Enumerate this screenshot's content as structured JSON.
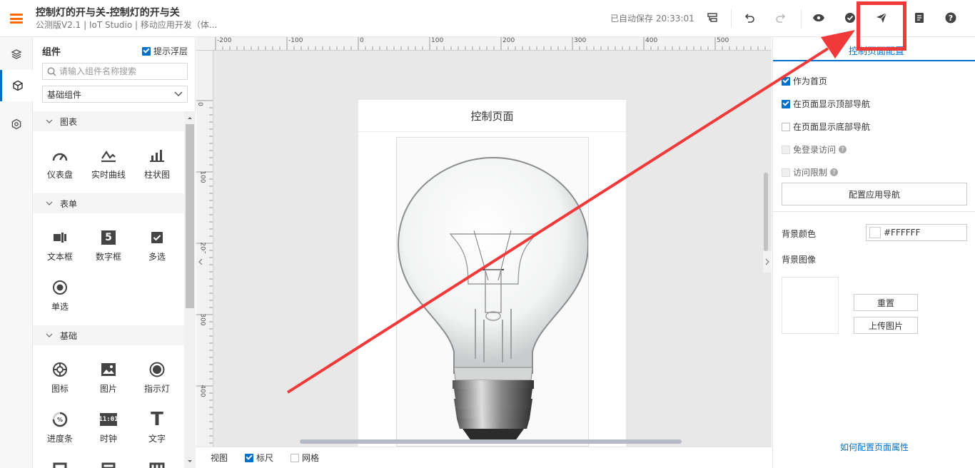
{
  "header": {
    "title": "控制灯的开与关-控制灯的开与关",
    "subtitle": "公测版V2.1 | IoT Studio | 移动应用开发（体...",
    "autosave": "已自动保存 20:33:01"
  },
  "components_panel": {
    "title": "组件",
    "hint_label": "提示浮层",
    "hint_checked": true,
    "search_placeholder": "请输入组件名称搜索",
    "category_select": "基础组件",
    "categories": [
      {
        "label": "图表",
        "items": [
          {
            "label": "仪表盘",
            "icon": "gauge-icon"
          },
          {
            "label": "实时曲线",
            "icon": "realtime-curve-icon"
          },
          {
            "label": "柱状图",
            "icon": "bar-chart-icon"
          }
        ]
      },
      {
        "label": "表单",
        "items": [
          {
            "label": "文本框",
            "icon": "textbox-icon"
          },
          {
            "label": "数字框",
            "icon": "number-box-icon"
          },
          {
            "label": "多选",
            "icon": "checkbox-icon"
          },
          {
            "label": "单选",
            "icon": "radio-icon"
          }
        ]
      },
      {
        "label": "基础",
        "items": [
          {
            "label": "图标",
            "icon": "icon-component-icon"
          },
          {
            "label": "图片",
            "icon": "image-icon"
          },
          {
            "label": "指示灯",
            "icon": "indicator-light-icon"
          },
          {
            "label": "进度条",
            "icon": "progress-icon"
          },
          {
            "label": "时钟",
            "icon": "clock-icon"
          },
          {
            "label": "文字",
            "icon": "text-icon"
          }
        ]
      }
    ],
    "number_icon_glyph": "5",
    "clock_icon_glyph": "11:01",
    "text_icon_glyph": "T"
  },
  "canvas": {
    "page_title": "控制页面",
    "ruler_h_labels": [
      "-200",
      "-100",
      "0",
      "100",
      "200",
      "300",
      "400",
      "500"
    ],
    "ruler_v_labels": [
      "0",
      "100",
      "200",
      "300",
      "400"
    ]
  },
  "bottom_bar": {
    "view_label": "视图",
    "ruler_label": "标尺",
    "ruler_checked": true,
    "grid_label": "网格",
    "grid_checked": false
  },
  "right_panel": {
    "tab_label": "控制页面配置",
    "options": [
      {
        "label": "作为首页",
        "checked": true,
        "disabled": false
      },
      {
        "label": "在页面显示顶部导航",
        "checked": true,
        "disabled": false
      },
      {
        "label": "在页面显示底部导航",
        "checked": false,
        "disabled": false
      },
      {
        "label": "免登录访问",
        "checked": false,
        "disabled": true,
        "help": true
      },
      {
        "label": "访问限制",
        "checked": false,
        "disabled": true,
        "help": true
      }
    ],
    "help_glyph": "?",
    "config_nav_button": "配置应用导航",
    "bg_color_label": "背景颜色",
    "bg_color_value": "#FFFFFF",
    "bg_image_label": "背景图像",
    "reset_button": "重置",
    "upload_button": "上传图片",
    "help_link": "如何配置页面属性"
  },
  "colors": {
    "accent": "#0070cc",
    "brand": "#ff6a00",
    "annotation": "#f03a3a"
  }
}
